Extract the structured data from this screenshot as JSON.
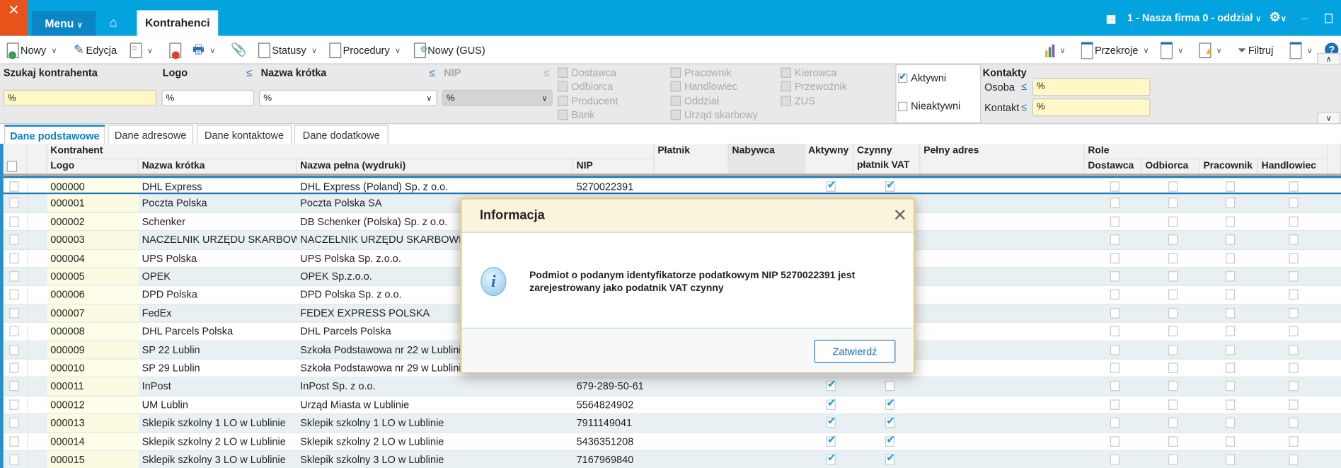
{
  "app": {
    "tab": "Kontrahenci",
    "menu": "Menu",
    "firm": "1 - Nasza firma 0 - oddział"
  },
  "colors": {
    "topbar": "#03a3e0",
    "logo": "#e8531c",
    "menu": "#0a85c6",
    "check": "#1ea0e0"
  },
  "toolbar": {
    "left": [
      "Nowy",
      "Edycja",
      "",
      "",
      "",
      "Statusy",
      "Procedury",
      "Nowy (GUS)"
    ],
    "przekroje": "Przekroje",
    "filtruj": "Filtruj"
  },
  "filters": {
    "search_label": "Szukaj kontrahenta",
    "search_value": "%",
    "logo_label": "Logo",
    "logo_value": "%",
    "short_label": "Nazwa krótka",
    "short_value": "%",
    "nip_label": "NIP",
    "nip_value": "%",
    "le": "≤",
    "types_col1": [
      "Dostawca",
      "Odbiorca",
      "Producent",
      "Bank"
    ],
    "types_col2": [
      "Pracownik",
      "Handlowiec",
      "Oddział",
      "Urząd skarbowy"
    ],
    "types_col3": [
      "Kierowca",
      "Przewoźnik",
      "ZUS"
    ],
    "active_label": "Aktywni",
    "active_checked": true,
    "inactive_label": "Nieaktywni",
    "inactive_checked": false,
    "contacts_label": "Kontakty",
    "person_label": "Osoba",
    "person_value": "%",
    "contact_label": "Kontakt",
    "contact_value": "%"
  },
  "tabs": [
    "Dane podstawowe",
    "Dane adresowe",
    "Dane kontaktowe",
    "Dane dodatkowe"
  ],
  "grid": {
    "group_kontrahent": "Kontrahent",
    "group_role": "Role",
    "cols": {
      "logo": "Logo",
      "short": "Nazwa krótka",
      "full": "Nazwa pełna (wydruki)",
      "nip": "NIP",
      "platnik": "Płatnik",
      "nabywca": "Nabywca",
      "aktywny": "Aktywny",
      "czynny1": "Czynny",
      "czynny2": "płatnik VAT",
      "adres": "Pełny adres",
      "dostawca": "Dostawca",
      "odbiorca": "Odbiorca",
      "pracownik": "Pracownik",
      "handlowiec": "Handlowiec"
    },
    "rows": [
      {
        "logo": "000000",
        "short": "DHL Express",
        "full": "DHL Express (Poland) Sp. z o.o.",
        "nip": "5270022391",
        "aktywny": true,
        "czynny": true
      },
      {
        "logo": "000001",
        "short": "Poczta Polska",
        "full": "Poczta Polska SA",
        "nip": "",
        "aktywny": null,
        "czynny": null
      },
      {
        "logo": "000002",
        "short": "Schenker",
        "full": "DB Schenker (Polska) Sp. z o.o.",
        "nip": "",
        "aktywny": null,
        "czynny": null
      },
      {
        "logo": "000003",
        "short": "NACZELNIK URZĘDU SKARBOWEGO",
        "full": "NACZELNIK URZĘDU SKARBOWEGO",
        "nip": "",
        "aktywny": null,
        "czynny": null
      },
      {
        "logo": "000004",
        "short": "UPS Polska",
        "full": "UPS Polska Sp. z.o.o.",
        "nip": "",
        "aktywny": null,
        "czynny": null
      },
      {
        "logo": "000005",
        "short": "OPEK",
        "full": "OPEK Sp.z.o.o.",
        "nip": "",
        "aktywny": null,
        "czynny": null
      },
      {
        "logo": "000006",
        "short": "DPD Polska",
        "full": "DPD Polska Sp. z o.o.",
        "nip": "",
        "aktywny": null,
        "czynny": null
      },
      {
        "logo": "000007",
        "short": "FedEx",
        "full": "FEDEX EXPRESS POLSKA",
        "nip": "",
        "aktywny": null,
        "czynny": null
      },
      {
        "logo": "000008",
        "short": "DHL Parcels Polska",
        "full": "DHL Parcels Polska",
        "nip": "",
        "aktywny": null,
        "czynny": null
      },
      {
        "logo": "000009",
        "short": "SP 22 Lublin",
        "full": "Szkoła Podstawowa nr 22 w Lublinie",
        "nip": "",
        "aktywny": null,
        "czynny": null
      },
      {
        "logo": "000010",
        "short": "SP 29 Lublin",
        "full": "Szkoła Podstawowa nr 29 w Lublinie",
        "nip": "",
        "aktywny": null,
        "czynny": null
      },
      {
        "logo": "000011",
        "short": "InPost",
        "full": "InPost Sp. z o.o.",
        "nip": "679-289-50-61",
        "aktywny": true,
        "czynny": false
      },
      {
        "logo": "000012",
        "short": "UM Lublin",
        "full": "Urząd Miasta w Lublinie",
        "nip": "5564824902",
        "aktywny": true,
        "czynny": true
      },
      {
        "logo": "000013",
        "short": "Sklepik szkolny 1 LO w Lublinie",
        "full": "Sklepik szkolny 1 LO w Lublinie",
        "nip": "7911149041",
        "aktywny": true,
        "czynny": true
      },
      {
        "logo": "000014",
        "short": "Sklepik szkolny 2 LO w Lublinie",
        "full": "Sklepik szkolny 2 LO w Lublinie",
        "nip": "5436351208",
        "aktywny": true,
        "czynny": true
      },
      {
        "logo": "000015",
        "short": "Sklepik szkolny 3 LO w Lublinie",
        "full": "Sklepik szkolny 3 LO w Lublinie",
        "nip": "7167969840",
        "aktywny": true,
        "czynny": true
      }
    ]
  },
  "dialog": {
    "title": "Informacja",
    "message": "Podmiot o podanym identyfikatorze podatkowym NIP 5270022391 jest zarejestrowany jako podatnik VAT czynny",
    "confirm": "Zatwierdź",
    "icon": "info-icon"
  }
}
